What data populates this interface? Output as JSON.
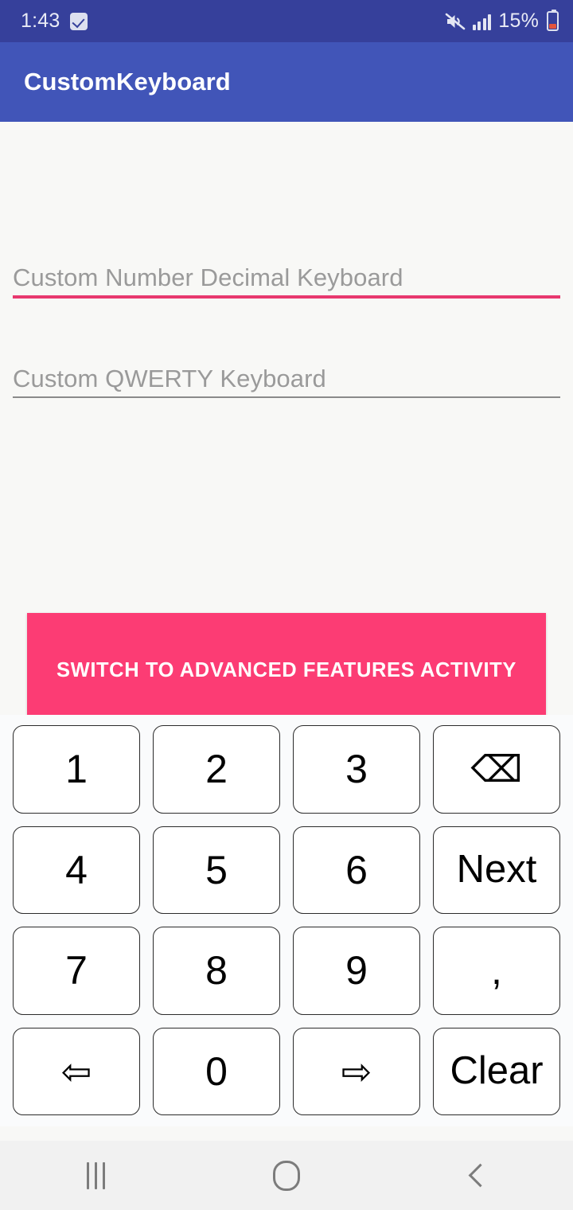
{
  "status_bar": {
    "time": "1:43",
    "checkbox_icon": "checkbox-checked-icon",
    "mute_icon": "volume-mute-icon",
    "signal_icon": "signal-bars-icon",
    "battery_percent": "15%",
    "battery_icon": "battery-low-icon",
    "background_color": "#36409B"
  },
  "action_bar": {
    "title": "CustomKeyboard",
    "background_color": "#4155B8",
    "text_color": "#FFFFFF"
  },
  "content": {
    "fields": [
      {
        "name": "decimal-keyboard-field",
        "placeholder": "Custom Number Decimal Keyboard",
        "value": "",
        "underline_color": "#E8386F",
        "focused": true
      },
      {
        "name": "qwerty-keyboard-field",
        "placeholder": "Custom QWERTY Keyboard",
        "value": "",
        "underline_color": "#8A8A8A",
        "focused": false
      }
    ],
    "switch_button": {
      "label": "SWITCH TO ADVANCED FEATURES ACTIVITY",
      "background_color": "#FC3C74",
      "text_color": "#FFFFFF"
    }
  },
  "keyboard": {
    "background_color": "#FAFBFC",
    "key_background": "#FFFFFF",
    "key_border": "#2B2B2B",
    "rows": [
      [
        {
          "label": "1",
          "name": "key-1",
          "type": "digit"
        },
        {
          "label": "2",
          "name": "key-2",
          "type": "digit"
        },
        {
          "label": "3",
          "name": "key-3",
          "type": "digit"
        },
        {
          "label": "⌫",
          "name": "key-backspace",
          "type": "glyph"
        }
      ],
      [
        {
          "label": "4",
          "name": "key-4",
          "type": "digit"
        },
        {
          "label": "5",
          "name": "key-5",
          "type": "digit"
        },
        {
          "label": "6",
          "name": "key-6",
          "type": "digit"
        },
        {
          "label": "Next",
          "name": "key-next",
          "type": "word"
        }
      ],
      [
        {
          "label": "7",
          "name": "key-7",
          "type": "digit"
        },
        {
          "label": "8",
          "name": "key-8",
          "type": "digit"
        },
        {
          "label": "9",
          "name": "key-9",
          "type": "digit"
        },
        {
          "label": ",",
          "name": "key-comma",
          "type": "comma"
        }
      ],
      [
        {
          "label": "⇦",
          "name": "key-arrow-left",
          "type": "glyph"
        },
        {
          "label": "0",
          "name": "key-0",
          "type": "digit"
        },
        {
          "label": "⇨",
          "name": "key-arrow-right",
          "type": "glyph"
        },
        {
          "label": "Clear",
          "name": "key-clear",
          "type": "word"
        }
      ]
    ]
  },
  "nav_bar": {
    "background_color": "#F1F1F1",
    "recents_icon": "recents-icon",
    "home_icon": "home-icon",
    "back_icon": "back-icon"
  }
}
